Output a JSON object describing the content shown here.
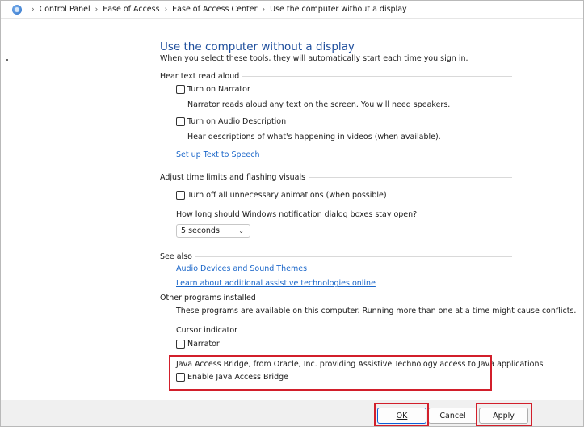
{
  "breadcrumb": {
    "items": [
      "Control Panel",
      "Ease of Access",
      "Ease of Access Center",
      "Use the computer without a display"
    ]
  },
  "header": {
    "title": "Use the computer without a display",
    "subtitle": "When you select these tools, they will automatically start each time you sign in."
  },
  "hear_text": {
    "heading": "Hear text read aloud",
    "narrator_label": "Turn on Narrator",
    "narrator_desc": "Narrator reads aloud any text on the screen. You will need speakers.",
    "audio_desc_label": "Turn on Audio Description",
    "audio_desc_desc": "Hear descriptions of what's happening in videos (when available).",
    "tts_link": "Set up Text to Speech"
  },
  "time_limits": {
    "heading": "Adjust time limits and flashing visuals",
    "animations_label": "Turn off all unnecessary animations (when possible)",
    "notification_question": "How long should Windows notification dialog boxes stay open?",
    "notification_value": "5 seconds"
  },
  "see_also": {
    "heading": "See also",
    "audio_link": "Audio Devices and Sound Themes",
    "assistive_link": "Learn about additional assistive technologies online"
  },
  "other_programs": {
    "heading": "Other programs installed",
    "desc": "These programs are available on this computer. Running more than one at a time might cause conflicts.",
    "cursor_indicator": "Cursor indicator",
    "narrator_label": "Narrator",
    "java_desc": "Java Access Bridge, from Oracle, Inc. providing Assistive Technology access to Java applications",
    "java_label": "Enable Java Access Bridge"
  },
  "buttons": {
    "ok": "OK",
    "cancel": "Cancel",
    "apply": "Apply"
  },
  "colors": {
    "title": "#1e4e9c",
    "link": "#1a66c9",
    "highlight": "#d21f2b"
  }
}
